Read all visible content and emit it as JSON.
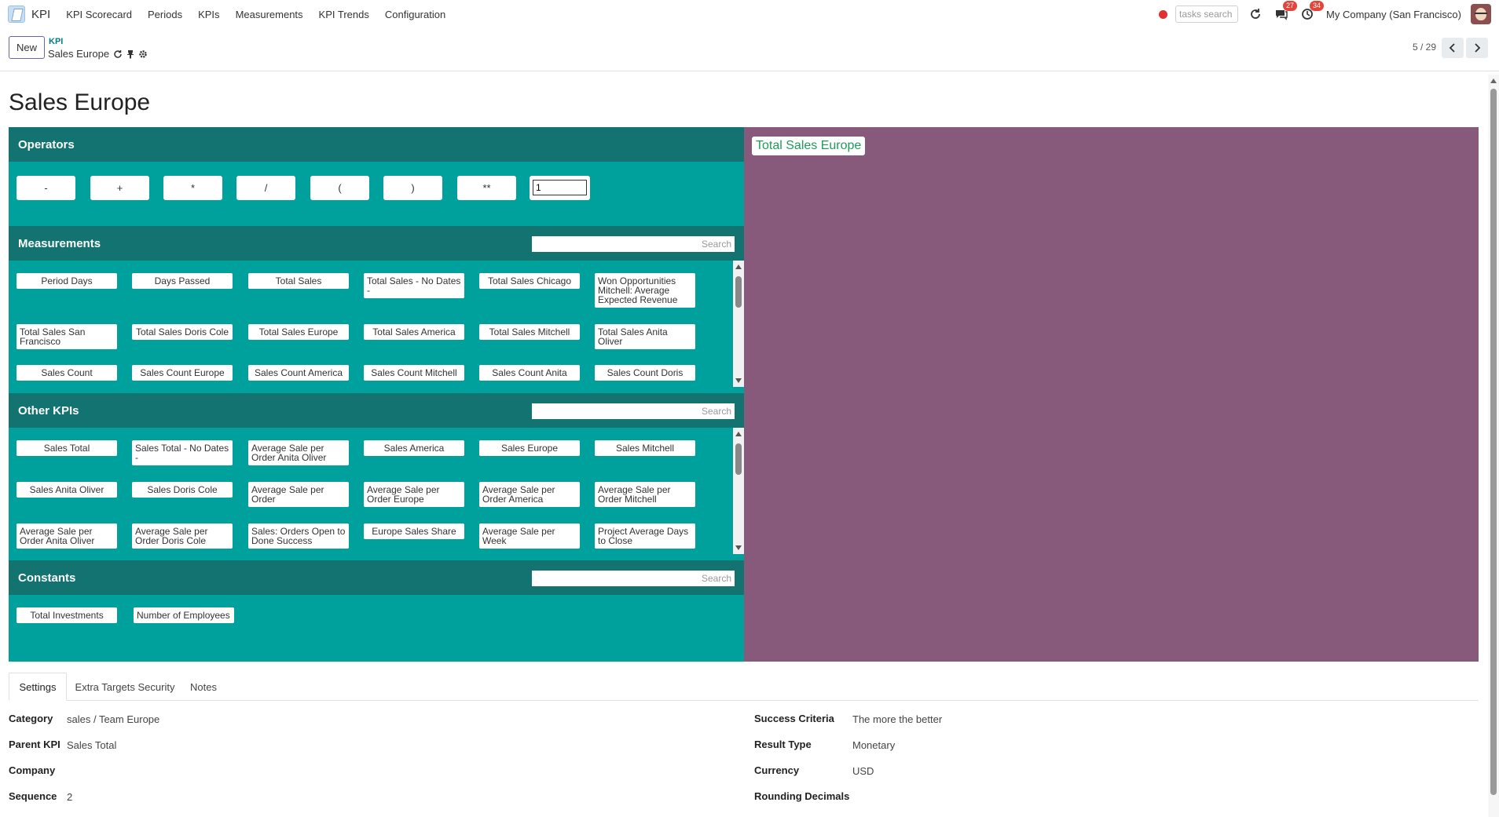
{
  "navbar": {
    "app_name": "KPI",
    "menu": [
      "KPI Scorecard",
      "Periods",
      "KPIs",
      "Measurements",
      "KPI Trends",
      "Configuration"
    ],
    "tasks_search_placeholder": "tasks search",
    "messages_count": "27",
    "activities_count": "34",
    "company": "My Company (San Francisco)"
  },
  "control": {
    "new_label": "New",
    "breadcrumb_parent": "KPI",
    "breadcrumb_current": "Sales Europe",
    "pager": "5 / 29"
  },
  "title": "Sales Europe",
  "operators": {
    "label": "Operators",
    "buttons": [
      "-",
      "+",
      "*",
      "/",
      "(",
      ")",
      "**"
    ],
    "number_value": "1"
  },
  "measurements": {
    "label": "Measurements",
    "search_placeholder": "Search",
    "items": [
      "Period Days",
      "Days Passed",
      "Total Sales",
      "Total Sales - No Dates -",
      "Total Sales Chicago",
      "Won Opportunities Mitchell: Average Expected Revenue",
      "Total Sales San Francisco",
      "Total Sales Doris Cole",
      "Total Sales Europe",
      "Total Sales America",
      "Total Sales Mitchell",
      "Total Sales Anita Oliver",
      "Sales Count",
      "Sales Count Europe",
      "Sales Count America",
      "Sales Count Mitchell",
      "Sales Count Anita",
      "Sales Count Doris"
    ]
  },
  "other_kpis": {
    "label": "Other KPIs",
    "search_placeholder": "Search",
    "items": [
      "Sales Total",
      "Sales Total - No Dates -",
      "Average Sale per Order Anita Oliver",
      "Sales America",
      "Sales Europe",
      "Sales Mitchell",
      "Sales Anita Oliver",
      "Sales Doris Cole",
      "Average Sale per Order",
      "Average Sale per Order Europe",
      "Average Sale per Order America",
      "Average Sale per Order Mitchell",
      "Average Sale per Order Anita Oliver",
      "Average Sale per Order Doris Cole",
      "Sales: Orders Open to Done Success",
      "Europe Sales Share",
      "Average Sale per Week",
      "Project Average Days to Close"
    ]
  },
  "constants": {
    "label": "Constants",
    "search_placeholder": "Search",
    "items": [
      "Total Investments",
      "Number of Employees"
    ]
  },
  "formula": {
    "tokens": [
      "Total Sales Europe"
    ]
  },
  "tabs": [
    "Settings",
    "Extra Targets Security",
    "Notes"
  ],
  "fields_left": [
    {
      "label": "Category",
      "value": "sales / Team Europe"
    },
    {
      "label": "Parent KPI",
      "value": "Sales Total"
    },
    {
      "label": "Company",
      "value": ""
    },
    {
      "label": "Sequence",
      "value": "2"
    }
  ],
  "fields_right": [
    {
      "label": "Success Criteria",
      "value": "The more the better"
    },
    {
      "label": "Result Type",
      "value": "Monetary"
    },
    {
      "label": "Currency",
      "value": "USD"
    },
    {
      "label": "Rounding Decimals",
      "value": ""
    }
  ],
  "colors": {
    "teal": "#00a09d",
    "teal_dark": "#127371",
    "purple": "#875a7b",
    "token_green": "#1f9c5a"
  }
}
